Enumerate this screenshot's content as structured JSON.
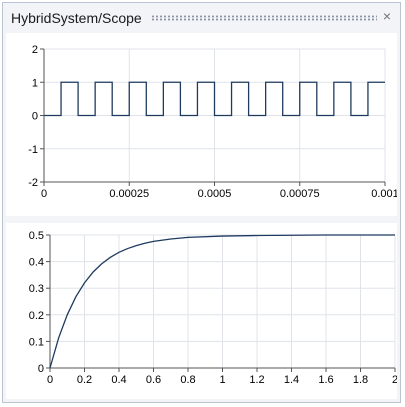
{
  "window": {
    "title": "HybridSystem/Scope"
  },
  "icons": {
    "close": "×"
  },
  "chart_data": [
    {
      "type": "line",
      "xlim": [
        0,
        0.001
      ],
      "ylim": [
        -2,
        2
      ],
      "x_ticks": [
        0,
        0.00025,
        0.0005,
        0.00075,
        0.001
      ],
      "x_tick_labels": [
        "0",
        "0.00025",
        "0.0005",
        "0.00075",
        "0.001"
      ],
      "y_ticks": [
        -2,
        -1,
        0,
        1,
        2
      ],
      "y_tick_labels": [
        "-2",
        "-1",
        "0",
        "1",
        "2"
      ],
      "grid": true,
      "line_color": "#1f3a5f",
      "series": [
        {
          "shape": "square-wave",
          "period": 0.0001,
          "low": 0,
          "high": 1,
          "first_rise": 5e-05,
          "duty": 0.5
        }
      ]
    },
    {
      "type": "line",
      "xlim": [
        0,
        2
      ],
      "ylim": [
        0,
        0.5
      ],
      "x_ticks": [
        0,
        0.2,
        0.4,
        0.6,
        0.8,
        1,
        1.2,
        1.4,
        1.6,
        1.8,
        2
      ],
      "x_tick_labels": [
        "0",
        "0.2",
        "0.4",
        "0.6",
        "0.8",
        "1",
        "1.2",
        "1.4",
        "1.6",
        "1.8",
        "2"
      ],
      "y_ticks": [
        0,
        0.1,
        0.2,
        0.3,
        0.4,
        0.5
      ],
      "y_tick_labels": [
        "0",
        "0.1",
        "0.2",
        "0.3",
        "0.4",
        "0.5"
      ],
      "grid": true,
      "line_color": "#1f3a5f",
      "series": [
        {
          "x": [
            0,
            0.05,
            0.1,
            0.15,
            0.2,
            0.25,
            0.3,
            0.35,
            0.4,
            0.45,
            0.5,
            0.55,
            0.6,
            0.7,
            0.8,
            1.0,
            1.2,
            1.4,
            1.6,
            1.8,
            2.0
          ],
          "y": [
            0,
            0.113,
            0.2,
            0.268,
            0.32,
            0.361,
            0.392,
            0.416,
            0.435,
            0.449,
            0.46,
            0.469,
            0.476,
            0.485,
            0.491,
            0.496,
            0.498,
            0.499,
            0.5,
            0.5,
            0.5
          ]
        }
      ]
    }
  ]
}
